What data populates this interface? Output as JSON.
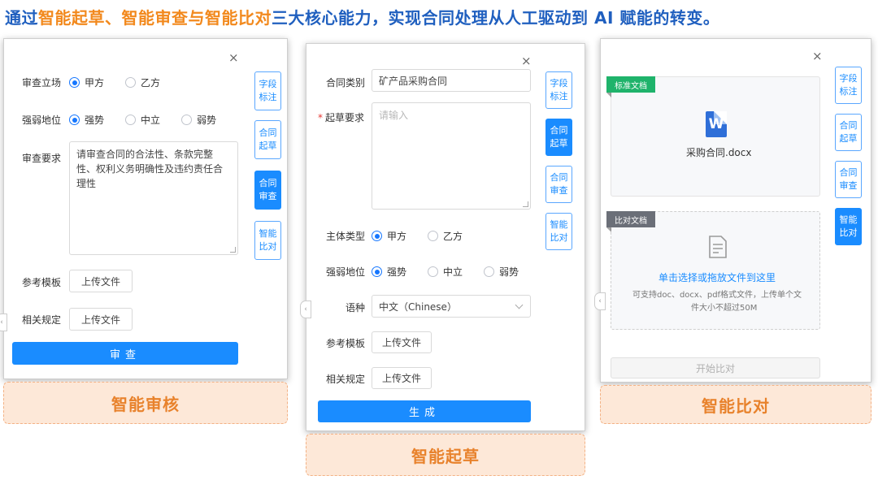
{
  "headline": {
    "part1": "通过",
    "part2": "智能起草、智能审查与智能比对",
    "part3": "三大核心能力，实现合同处理从人工驱动到 AI 赋能的转变。"
  },
  "review_panel": {
    "close": "×",
    "stance_label": "审查立场",
    "stance_options": [
      "甲方",
      "乙方"
    ],
    "stance_selected": "甲方",
    "position_label": "强弱地位",
    "position_options": [
      "强势",
      "中立",
      "弱势"
    ],
    "position_selected": "强势",
    "requirement_label": "审查要求",
    "requirement_value": "请审查合同的合法性、条款完整性、权利义务明确性及违约责任合理性",
    "template_label": "参考模板",
    "template_button": "上传文件",
    "rules_label": "相关规定",
    "rules_button": "上传文件",
    "submit_button": "审查",
    "side_tabs": [
      "字段标注",
      "合同起草",
      "合同审查",
      "智能比对"
    ],
    "side_active": "合同审查",
    "caption": "智能审核"
  },
  "draft_panel": {
    "close": "×",
    "type_label": "合同类别",
    "type_value": "矿产品采购合同",
    "requirement_label": "起草要求",
    "requirement_placeholder": "请输入",
    "subject_label": "主体类型",
    "subject_options": [
      "甲方",
      "乙方"
    ],
    "subject_selected": "甲方",
    "position_label": "强弱地位",
    "position_options": [
      "强势",
      "中立",
      "弱势"
    ],
    "position_selected": "强势",
    "language_label": "语种",
    "language_value": "中文（Chinese）",
    "template_label": "参考模板",
    "template_button": "上传文件",
    "rules_label": "相关规定",
    "rules_button": "上传文件",
    "submit_button": "生成",
    "side_tabs": [
      "字段标注",
      "合同起草",
      "合同审查",
      "智能比对"
    ],
    "side_active": "合同起草",
    "caption": "智能起草"
  },
  "compare_panel": {
    "close": "×",
    "standard_tag": "标准文档",
    "standard_file": "采购合同.docx",
    "word_icon_letter": "W",
    "compare_tag": "比对文档",
    "upload_title": "单击选择或拖放文件到这里",
    "upload_hint_line1": "可支持doc、docx、pdf格式文件，上传单个文",
    "upload_hint_line2": "件大小不超过50M",
    "start_button": "开始比对",
    "side_tabs": [
      "字段标注",
      "合同起草",
      "合同审查",
      "智能比对"
    ],
    "side_active": "智能比对",
    "caption": "智能比对"
  },
  "colors": {
    "accent": "#1a8cff",
    "headline_blue": "#1f5fbf",
    "headline_orange": "#f2891d",
    "caption_bg": "#fde8d8",
    "caption_text": "#e8822c",
    "standard_tag": "#1fb36b",
    "compare_tag": "#6b6f78"
  }
}
